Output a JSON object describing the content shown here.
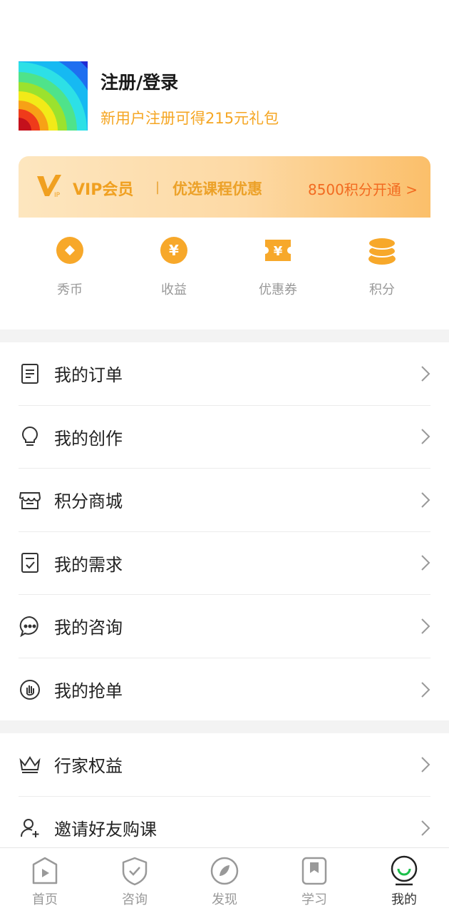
{
  "profile": {
    "title": "注册/登录",
    "subtitle": "新用户注册可得215元礼包"
  },
  "vip": {
    "title": "VIP会员",
    "separator": "|",
    "description": "优选课程优惠",
    "action": "8500积分开通 >"
  },
  "stats": [
    {
      "label": "秀币",
      "icon": "coin-icon"
    },
    {
      "label": "收益",
      "icon": "yuan-icon"
    },
    {
      "label": "优惠券",
      "icon": "coupon-icon"
    },
    {
      "label": "积分",
      "icon": "points-stack-icon"
    }
  ],
  "menu_primary": [
    {
      "label": "我的订单",
      "icon": "order-icon"
    },
    {
      "label": "我的创作",
      "icon": "bulb-icon"
    },
    {
      "label": "积分商城",
      "icon": "store-icon"
    },
    {
      "label": "我的需求",
      "icon": "checklist-icon"
    },
    {
      "label": "我的咨询",
      "icon": "chat-icon"
    },
    {
      "label": "我的抢单",
      "icon": "hand-icon"
    }
  ],
  "menu_secondary": [
    {
      "label": "行家权益",
      "icon": "crown-icon"
    },
    {
      "label": "邀请好友购课",
      "icon": "invite-user-icon"
    }
  ],
  "tabs": [
    {
      "label": "首页",
      "icon": "home-play-icon"
    },
    {
      "label": "咨询",
      "icon": "shield-check-icon"
    },
    {
      "label": "发现",
      "icon": "compass-icon"
    },
    {
      "label": "学习",
      "icon": "bookmark-icon"
    },
    {
      "label": "我的",
      "icon": "profile-smile-icon",
      "active": true
    }
  ],
  "colors": {
    "accent_orange": "#f5a623",
    "vip_action": "#f26a20",
    "icon_gold": "#f7a82a"
  }
}
